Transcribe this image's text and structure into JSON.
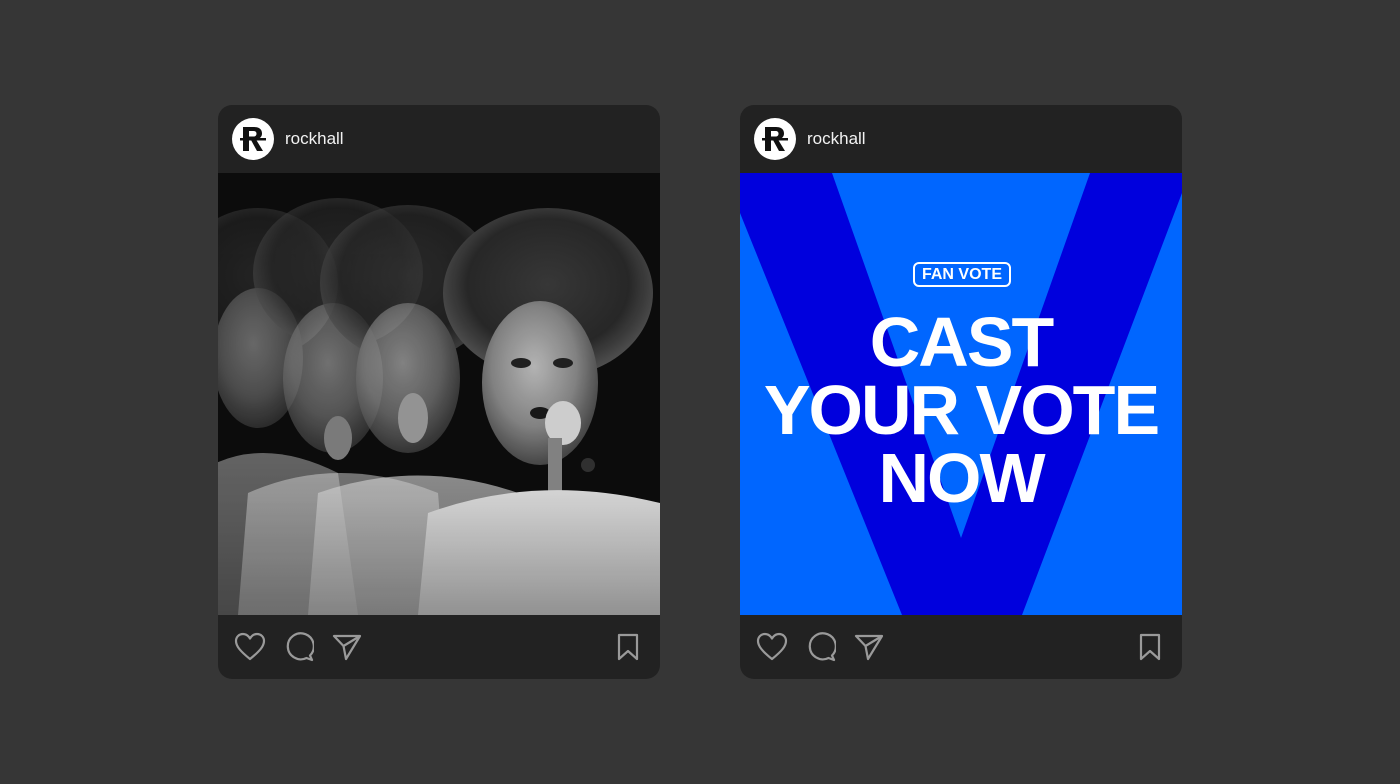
{
  "posts": [
    {
      "account": {
        "username": "rockhall",
        "avatar_icon": "rock-hall-r-logo"
      },
      "media": {
        "kind": "photo",
        "style": "black-and-white multiple-exposure concert photo of a singer with a microphone"
      },
      "actions": {
        "like_icon": "heart-icon",
        "comment_icon": "comment-icon",
        "share_icon": "send-icon",
        "save_icon": "bookmark-icon"
      }
    },
    {
      "account": {
        "username": "rockhall",
        "avatar_icon": "rock-hall-r-logo"
      },
      "media": {
        "kind": "graphic",
        "badge": "FAN VOTE",
        "headline": [
          "CAST",
          "YOUR VOTE",
          "NOW"
        ],
        "colors": {
          "background": "#0066FF",
          "chevron": "#0000DD",
          "text": "#FFFFFF"
        }
      },
      "actions": {
        "like_icon": "heart-icon",
        "comment_icon": "comment-icon",
        "share_icon": "send-icon",
        "save_icon": "bookmark-icon"
      }
    }
  ],
  "colors": {
    "page_background": "#363636",
    "card_background": "#222222",
    "icon_stroke": "#9a9a9a"
  }
}
